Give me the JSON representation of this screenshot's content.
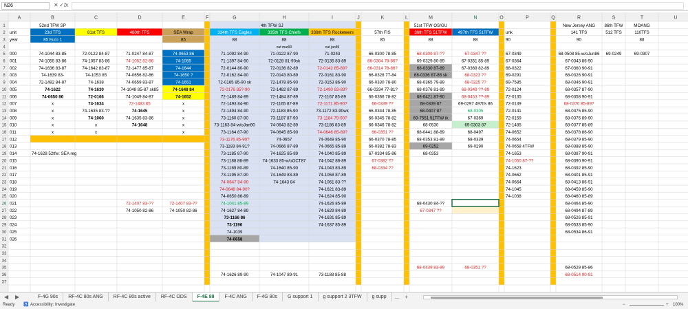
{
  "formula_bar": {
    "name_box": "N26",
    "cancel": "✕",
    "enter": "✓",
    "fx": "fx"
  },
  "cols": [
    "A",
    "B",
    "C",
    "D",
    "E",
    "F",
    "G",
    "H",
    "I",
    "J",
    "K",
    "L",
    "M",
    "N",
    "O",
    "P",
    "Q",
    "R",
    "S",
    "T",
    "U"
  ],
  "rows": [
    "1",
    "2",
    "3",
    "4",
    "5",
    "6",
    "7",
    "8",
    "9",
    "10",
    "11",
    "12",
    "13",
    "14",
    "15",
    "16",
    "17",
    "18",
    "19",
    "20",
    "21",
    "22",
    "23",
    "24",
    "25",
    "26",
    "27",
    "28",
    "29",
    "30",
    "31",
    "32",
    "33",
    "34",
    "35",
    "36",
    "37"
  ],
  "colors": {
    "blue": "#0070c0",
    "yellow": "#ffff00",
    "orange": "#ffc000",
    "red": "#ff0000",
    "tan": "#c9a15a",
    "teal": "#00b0f0",
    "green": "#00b050",
    "lav": "#d9e1f2",
    "gray": "#a6a6a6",
    "lgreen": "#c6efce",
    "redtext": "#e02020",
    "cream": "#fff2cc"
  },
  "cells": {
    "B1": "52nd TFW SP",
    "H1": "4th TFW SJ",
    "M1": "51st TFW OS/GU",
    "R1": "New Jersey ANG",
    "S1": "86th TFW",
    "T1": "MOANG",
    "A2": "unit",
    "B2": "23d TFS",
    "C2": "81st TFS",
    "D2": "480th TFS",
    "E2": "SEA Wrap",
    "G2": "334th TFS Eagles",
    "H2": "335th TFS Chiefs",
    "I2": "336th TFS Rocketeers",
    "K2": "57th FIS",
    "M2": "36th TFS 51TFW",
    "N2": "497th TFS 51TFW",
    "P2": "unk",
    "R2": "141 TFS",
    "S2": "512 TFS",
    "T2": "110TFS",
    "A3": "year",
    "B3": "85 Euro 1",
    "E3": "85",
    "G3": "88",
    "H3": "88",
    "I3": "88",
    "K3": "85",
    "M3": "88",
    "N3": "88",
    "P3": "90",
    "R3": "90",
    "T3": "88",
    "H4": "out mar90",
    "I4": "out jan89",
    "A5": "000",
    "B5": "74-1044 83-85",
    "C5": "72-0122 84-87",
    "D5": "71-0247 84-87",
    "E5": "74-0653 86",
    "G5": "71-1092 84-90",
    "H5": "71-0122 87-90",
    "I5": "71-0243",
    "K5": "66-0300 78-85",
    "M5": "68-0309 87-??",
    "N5": "67-0347 ??",
    "P5": "67-0349",
    "R5": "68-0508 85-w/oJun86",
    "S5": "69-0249",
    "T5": "69-0307",
    "A6": "001",
    "B6": "74-1055 83-86",
    "C6": "74-1057 83-86",
    "D6": "74-1052 82-86",
    "E6": "74-1059",
    "G6": "71-1397 84-90",
    "H6": "72-0128 81-90sk",
    "I6": "72-0135 83-89",
    "K6": "66-0304 78-86?",
    "M6": "69-0329 80-89",
    "N6": "67-0351 85-89",
    "P6": "67-0364",
    "R6": "67-0343 86-90",
    "A7": "002",
    "B7": "74-1636 83-87",
    "C7": "74-1642 83-87",
    "D7": "72-1477 85-87",
    "E7": "74-1644",
    "G7": "72-0144 80-90",
    "H7": "72-0136 82-89",
    "I7": "72-0142 85-89?",
    "K7": "66-0314 78-86?",
    "M7": "68-0330 87-89",
    "N7": "67-0369 82-89",
    "P7": "68-0322",
    "R7": "67-0360 90-91",
    "A8": "003",
    "B8": "74-1639 83-",
    "C8": "74-1053 85",
    "D8": "74-0656 82-86",
    "E8": "74-1650 ?",
    "G8": "72-0162 84-90",
    "H8": "72-0143 80-89",
    "I8": "72-0161 83-90",
    "K8": "66-0328 77-84",
    "M8": "68-0336 87-88 sk",
    "N8": "68-0323 ??",
    "P8": "69-0291",
    "R8": "68-0326 90-91",
    "A9": "004",
    "B9": "72-1482 84-87",
    "C9": "74-1638",
    "D9": "74-0659 83-87",
    "E9": "74-1651",
    "G9": "72-0165 85-90 sk",
    "H9": "72-1478 85-90",
    "I9": "72-0153 86-90",
    "K9": "66-0330 78-80",
    "M9": "68-0365 79-89",
    "N9": "68-0325 ??",
    "P9": "69-7585",
    "R9": "68-0346 90-91",
    "A10": "005",
    "B10": "74-1622",
    "C10": "74-1630",
    "D10": "74-1048 85-87 sk85",
    "E10": "74-1648 84",
    "G10": "72-0176 85?-90",
    "H10": "72-1482 87-89",
    "I10": "72-1490 83-89?",
    "K10": "66-0334 77-81?",
    "M10": "68-0376 81-89",
    "N10": "68-0349 ??-89",
    "P10": "72-0124",
    "R10": "68-0357 87-90",
    "A11": "006",
    "B11": "74-0650 86",
    "C11": "72-0166",
    "D11": "74-1049 84-87",
    "E11": "74-1652",
    "G11": "72-1489 84-89",
    "H11": "72-1484 87-89",
    "I11": "72-1167 85-89",
    "K11": "66-0366 78-82",
    "M11": "68-0421 87-90",
    "N11": "68-0453 ??-89",
    "P11": "72-0135",
    "R11": "68-0358 90-91",
    "A12": "007",
    "B12": "x",
    "C12": "74-1634",
    "D12": "72-1483 85",
    "E12": "x",
    "G12": "72-1493 84-90",
    "H12": "72-1165 87-89",
    "I12": "72-1171 85-90?",
    "K12": "66-0339 ??",
    "M12": "68-0339 87",
    "N12": "69-0297 497tfs 86",
    "P12": "72-0139",
    "R12": "68-0370 85-89?",
    "A13": "008",
    "B13": "x",
    "C13": "74-1635 83-??",
    "D13": "74-1645",
    "E13": "x",
    "G13": "72-1494 84-90",
    "H13": "72-1183 85-90",
    "I13": "73-1172 83-90wk",
    "K13": "66-0344 78-85",
    "M13": "68-0407 87",
    "N13": "68-0305",
    "P13": "72-0141",
    "R13": "68-0375 85-90",
    "A14": "009",
    "B14": "x",
    "C14": "74-1060",
    "D14": "74-1635 83-86",
    "E14": "x",
    "G14": "73-1160 87-90",
    "H14": "73-1187 87-90",
    "I14": "73-1184 79-90?",
    "K14": "66-0345 78-82",
    "M14": "69-7551 51TFW ik",
    "N14": "67-0369",
    "P14": "72-0159",
    "R14": "68-0376 89-90",
    "A15": "010",
    "B15": "x",
    "C15": "x",
    "D15": "74-1648",
    "E15": "x",
    "G15": "73-1163 84-w/oJan90",
    "H15": "74-0643 82-89",
    "I15": "73-1186 83-89",
    "K15": "66-0346 78-82",
    "M15": "68-0530",
    "N15": "69-0303 87",
    "P15": "72-1485",
    "R15": "68-0377 85-89",
    "A16": "011",
    "B16": "x",
    "C16": "x",
    "E16": "x",
    "G16": "73-1164 87-90",
    "H16": "74-0645 85-90",
    "I16": "74-0646 85-89?",
    "K16": "66-0351 ??",
    "M16": "68-0441 88-89",
    "N16": "68-0497",
    "P16": "74-0652",
    "R16": "68-0378 86-90",
    "A17": "012",
    "G17": "73-1176 85-90?",
    "H17": "74-0657",
    "I17": "74-0649 85-90",
    "K17": "66-0370 78-85",
    "M17": "68-0353 81-89",
    "N17": "68-0339",
    "P17": "74-0654",
    "R17": "68-0379 85-90",
    "A18": "013",
    "G18": "73-1183 84-91?",
    "H18": "74-0666 87-89",
    "I18": "74-0665 85-89",
    "K18": "66-0382 78-83",
    "M18": "69-0252",
    "N18": "69-0290",
    "P18": "74-0658 4TFW",
    "R18": "68-0388 85-90",
    "A19": "014",
    "B19": "74-1628 52tfw: SEA reg",
    "G19": "73-1185 87-90",
    "H19": "74-1625 85-89",
    "I19": "74-1040 85-89",
    "K19": "67-0334 85-86",
    "M19": "68-0353",
    "P19": "74-1653",
    "R19": "68-0387 90-91",
    "A20": "015",
    "G20": "73-1188 88-89",
    "H20": "74-1633 85-w/oOCT87",
    "I20": "74-1042 86-89",
    "K20": "67-0382 ??",
    "P20": "74-1050 87-??",
    "R20": "68-0390 90-91",
    "A21": "016",
    "G21": "73-1189 80-89",
    "H21": "74-1640 85-90",
    "I21": "74-1043 83-89",
    "K21": "68-0334 ??",
    "P21": "74-1623",
    "R21": "68-0392 85-90",
    "A22": "017",
    "G22": "73-1195 87-90",
    "H22": "74-1649 83-89",
    "I22": "74-1058 87-89",
    "P22": "74-0662",
    "R22": "68-0401 85-91",
    "A23": "018",
    "G23": "74-0647 84-90",
    "H23": "74-1643 84",
    "I23": "74-1061 83-??",
    "P23": "74-0664",
    "R23": "68-0413 86-91",
    "A24": "019",
    "G24": "74-0648 84-90?",
    "I24": "74-1621 83-89",
    "P24": "74-1045",
    "R24": "68-0459 85-90",
    "A25": "020",
    "G25": "74-0650 86-89",
    "I25": "74-1624 85-90",
    "P25": "74-1038",
    "R25": "68-0460 85-89",
    "A26": "021",
    "D26": "72-1407 83-??",
    "E26": "72-1407 83-??",
    "G26": "74-1041 85-89",
    "I26": "74-1626 85-89",
    "M26": "68-0430 84-??",
    "R26": "68-0464 85-90",
    "A27": "022",
    "D27": "74-1050 82-86",
    "E27": "74-1050 82-86",
    "G27": "74-1627 84-89",
    "I27": "74-1629 84-89",
    "M27": "67-0347 ??",
    "R27": "68-0494 87-89",
    "A28": "023",
    "G28": "73-1166 86",
    "I28": "74-1631 85-89",
    "R28": "68-0526 85-91",
    "A29": "024",
    "G29": "73-1196",
    "I29": "74-1637 85-89",
    "R29": "68-0533 85-90",
    "A30": "025",
    "G30": "74-1039",
    "R30": "68-0534 86-91",
    "A31": "026",
    "G31": "74-0658",
    "M35": "68-0439 83-89",
    "N35": "68-0351 ??",
    "R35": "68-0529 85-86",
    "G36": "74-1626 89-90",
    "H36": "74-1047 89-91",
    "I36": "73-1188 85-88",
    "R36": "68-0514 90-91"
  },
  "styles": {
    "B2": "blue",
    "C2": "yellow",
    "D2": "red",
    "E2": "tan",
    "G2": "teal",
    "H2": "green",
    "I2": "orange",
    "M2": "red",
    "N2": "blue",
    "B3": "blue",
    "E3": "tan",
    "E5": "blue",
    "E6": "blue",
    "E7": "blue",
    "E8": "blue",
    "E9": "blue",
    "E10": "yellow",
    "E11": "yellow",
    "B17": "orange",
    "C17": "orange",
    "D17": "orange",
    "E17": "orange",
    "M7": "gray",
    "M8": "gray",
    "M11": "gray",
    "M12": "gray",
    "M13": "gray",
    "M14": "gray",
    "M18": "gray",
    "G31": "gray",
    "N15": "lgreen",
    "N27": "cream",
    "N26": "selected"
  },
  "red_text": [
    "M2",
    "D6",
    "I7",
    "K6",
    "K7",
    "M5",
    "N5",
    "N8",
    "N9",
    "N10",
    "N11",
    "G10",
    "I10",
    "I12",
    "K12",
    "R12",
    "D12",
    "I14",
    "G17",
    "I16",
    "K16",
    "K20",
    "K21",
    "P20",
    "G23",
    "G24",
    "D26",
    "E26",
    "M27",
    "M35",
    "N35",
    "R36"
  ],
  "green_text": [
    "G26",
    "N13"
  ],
  "bold": [
    "B10",
    "C10",
    "B11",
    "C11",
    "C12",
    "D13",
    "C14",
    "D15",
    "E10",
    "E11",
    "G28",
    "G29",
    "G31"
  ],
  "sheet_tabs": [
    "F-4G 90s",
    "RF-4C 80s ANG",
    "RF-4C 80s active",
    "RF-4C ODS",
    "F-4E 88",
    "F-4C ANG",
    "F-4G 80s",
    "G support 1",
    "g support 2 3TFW",
    "g supp"
  ],
  "active_tab": "F-4E 88",
  "tab_more": "...",
  "tab_add": "+",
  "status": {
    "ready": "Ready",
    "accessibility": "Accessibility: Investigate",
    "zoom": "100%"
  }
}
